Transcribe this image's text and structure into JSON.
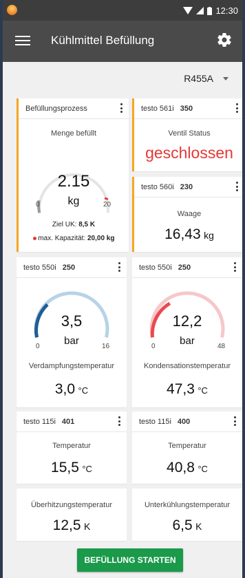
{
  "status_bar": {
    "time": "12:30"
  },
  "app_bar": {
    "title": "Kühlmittel Befüllung"
  },
  "refrigerant": {
    "selected": "R455A"
  },
  "fill_card": {
    "title": "Befüllungsprozess",
    "label": "Menge befüllt",
    "value": "2.15",
    "unit": "kg",
    "gauge_min": "0",
    "gauge_max": "20",
    "target_label": "Ziel UK:",
    "target_value": "8,5 K",
    "capacity_label": "max. Kapazität:",
    "capacity_value": "20,00 kg"
  },
  "valve_card": {
    "device": "testo 561i",
    "device_num": "350",
    "label": "Ventil Status",
    "value": "geschlossen"
  },
  "scale_card": {
    "device": "testo 560i",
    "device_num": "230",
    "label": "Waage",
    "value": "16,43",
    "unit": "kg"
  },
  "low_pressure_card": {
    "device": "testo 550i",
    "device_num": "250",
    "value": "3,5",
    "unit": "bar",
    "gauge_min": "0",
    "gauge_max": "16",
    "temp_label": "Verdampfungstemperatur",
    "temp_value": "3,0",
    "temp_unit": "°C"
  },
  "high_pressure_card": {
    "device": "testo 550i",
    "device_num": "250",
    "value": "12,2",
    "unit": "bar",
    "gauge_min": "0",
    "gauge_max": "48",
    "temp_label": "Kondensationstemperatur",
    "temp_value": "47,3",
    "temp_unit": "°C"
  },
  "temp_card_1": {
    "device": "testo 115i",
    "device_num": "401",
    "label": "Temperatur",
    "value": "15,5",
    "unit": "°C"
  },
  "temp_card_2": {
    "device": "testo 115i",
    "device_num": "400",
    "label": "Temperatur",
    "value": "40,8",
    "unit": "°C"
  },
  "superheat_card": {
    "label": "Überhitzungstemperatur",
    "value": "12,5",
    "unit": "K"
  },
  "subcool_card": {
    "label": "Unterkühlungstemperatur",
    "value": "6,5",
    "unit": "K"
  },
  "start_button": {
    "label": "BEFÜLLUNG STARTEN"
  },
  "colors": {
    "accent_orange": "#f5a623",
    "closed_red": "#e53935",
    "low_blue": "#1f5d96",
    "high_red": "#e84a50",
    "button_green": "#1a9a4a"
  }
}
